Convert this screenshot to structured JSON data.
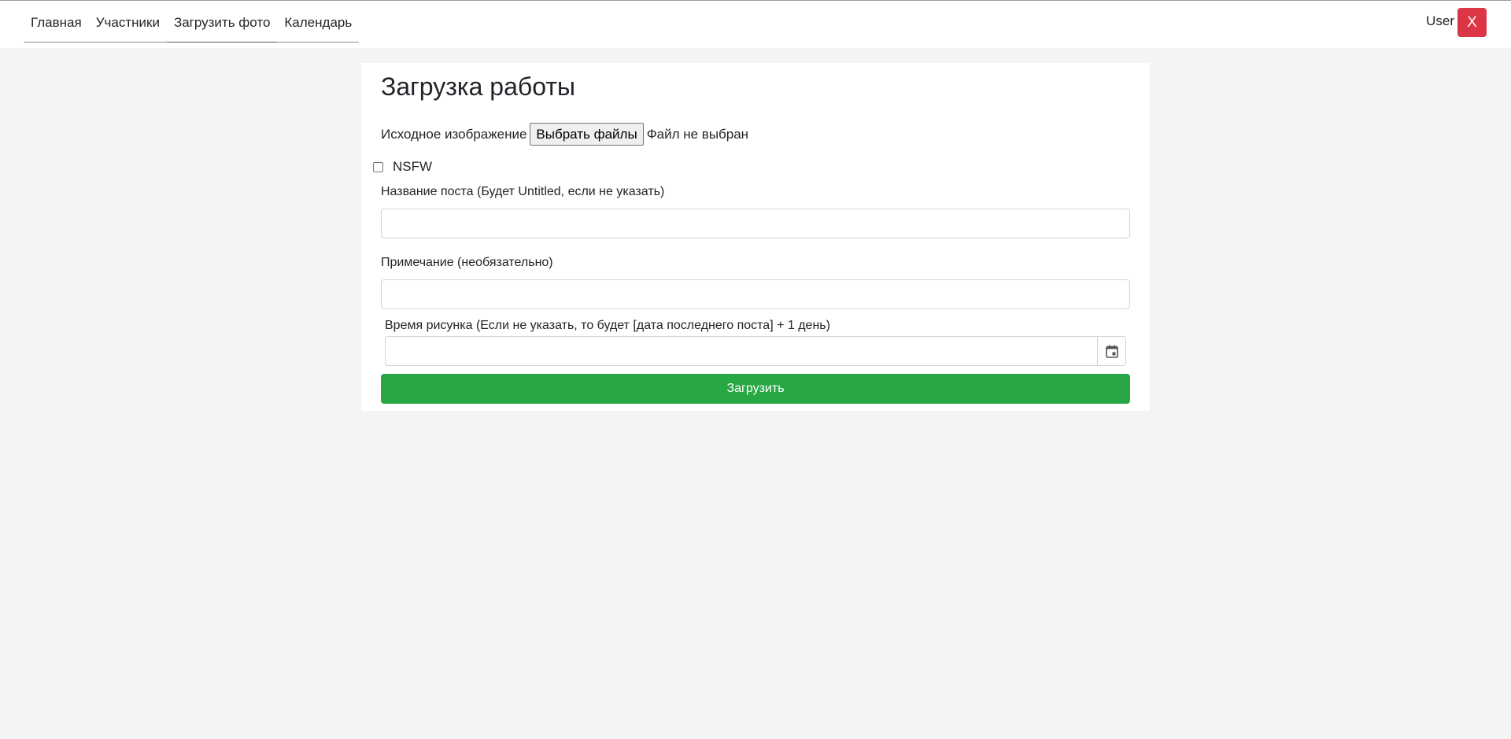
{
  "nav": {
    "items": [
      {
        "label": "Главная"
      },
      {
        "label": "Участники"
      },
      {
        "label": "Загрузить фото"
      },
      {
        "label": "Календарь"
      }
    ],
    "active_index": 2
  },
  "user": {
    "name": "User",
    "logout_label": "X"
  },
  "form": {
    "title": "Загрузка работы",
    "file": {
      "label": "Исходное изображение",
      "button_label": "Выбрать файлы",
      "status": "Файл не выбран"
    },
    "nsfw": {
      "label": "NSFW",
      "checked": false
    },
    "post_title": {
      "label": "Название поста (Будет Untitled, если не указать)",
      "value": ""
    },
    "note": {
      "label": "Примечание (необязательно)",
      "value": ""
    },
    "drawing_time": {
      "label": "Время рисунка (Если не указать, то будет [дата последнего поста] + 1 день)",
      "value": ""
    },
    "submit_label": "Загрузить"
  },
  "colors": {
    "background": "#f4f4f4",
    "danger": "#dc3545",
    "success": "#28a745"
  },
  "icons": {
    "date_picker": "calendar-icon"
  }
}
